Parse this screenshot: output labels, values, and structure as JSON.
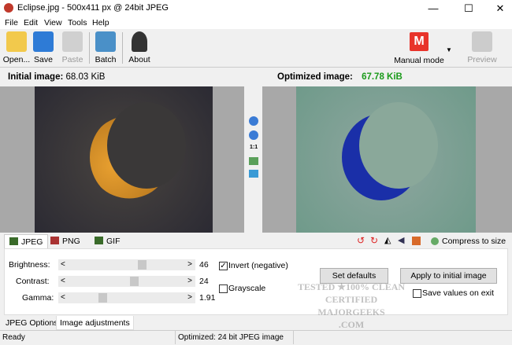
{
  "window": {
    "title": "Eclipse.jpg - 500x411 px @ 24bit JPEG",
    "minimize": "—",
    "maximize": "☐",
    "close": "✕"
  },
  "menu": [
    "File",
    "Edit",
    "View",
    "Tools",
    "Help"
  ],
  "toolbar": {
    "open": "Open...",
    "save": "Save",
    "paste": "Paste",
    "batch": "Batch",
    "about": "About",
    "mode_letter": "M",
    "mode": "Manual mode",
    "preview": "Preview"
  },
  "initial": {
    "label": "Initial image:",
    "size": "68.03 KiB"
  },
  "optimized": {
    "label": "Optimized image:",
    "size": "67.78 KiB",
    "size_color": "#1a9a1a"
  },
  "zoom_tools": {
    "one_to_one": "1:1"
  },
  "format_tabs": [
    "JPEG",
    "PNG",
    "GIF"
  ],
  "compress": "Compress to size",
  "adjust": {
    "brightness": {
      "label": "Brightness:",
      "value": "46",
      "level": 0.64
    },
    "contrast": {
      "label": "Contrast:",
      "value": "24",
      "level": 0.57
    },
    "gamma": {
      "label": "Gamma:",
      "value": "1.91",
      "level": 0.28
    },
    "invert": {
      "label": "Invert (negative)",
      "checked": true
    },
    "grayscale": {
      "label": "Grayscale",
      "checked": false
    },
    "set_defaults": "Set defaults",
    "apply": "Apply to initial image",
    "save_values": {
      "label": "Save values on exit",
      "checked": false
    }
  },
  "bottom_tabs": [
    "JPEG Options",
    "Image adjustments"
  ],
  "status": {
    "left": "Ready",
    "middle": "Optimized: 24 bit JPEG image"
  },
  "watermark": "TESTED ★100% CLEAN CERTIFIED MAJORGEEKS .COM"
}
